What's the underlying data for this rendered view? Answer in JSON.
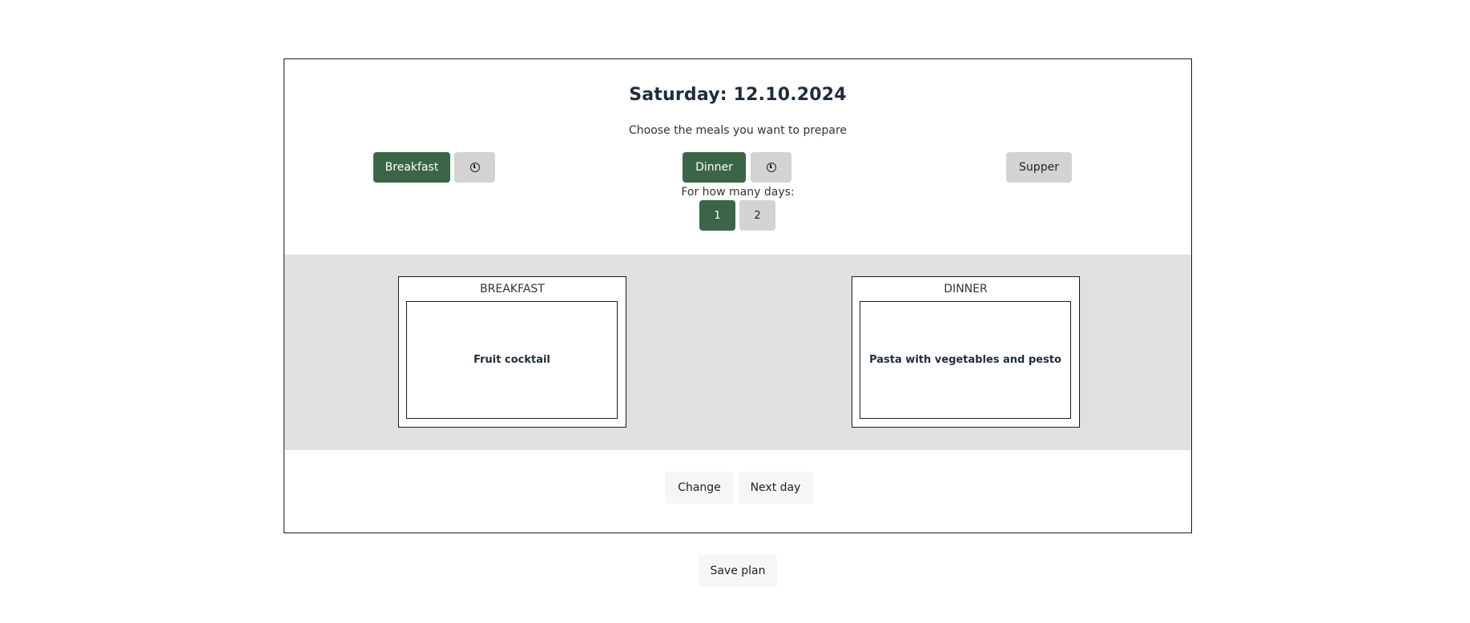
{
  "day": {
    "title": "Saturday: 12.10.2024"
  },
  "meal_selection": {
    "prompt": "Choose the meals you want to prepare",
    "options": [
      {
        "label": "Breakfast",
        "selected": true,
        "has_time_button": true
      },
      {
        "label": "Dinner",
        "selected": true,
        "has_time_button": true
      },
      {
        "label": "Supper",
        "selected": false,
        "has_time_button": false
      }
    ],
    "time_icon": "clock-icon"
  },
  "days_count": {
    "label": "For how many days:",
    "options": [
      "1",
      "2"
    ],
    "selected": "1"
  },
  "meals": [
    {
      "heading": "BREAKFAST",
      "dish": "Fruit cocktail"
    },
    {
      "heading": "DINNER",
      "dish": "Pasta with vegetables and pesto"
    }
  ],
  "actions": {
    "change_label": "Change",
    "next_day_label": "Next day",
    "save_label": "Save plan"
  },
  "colors": {
    "accent": "#3a6647",
    "idle_button": "#d3d3d3",
    "band_background": "#e0e0e0"
  }
}
